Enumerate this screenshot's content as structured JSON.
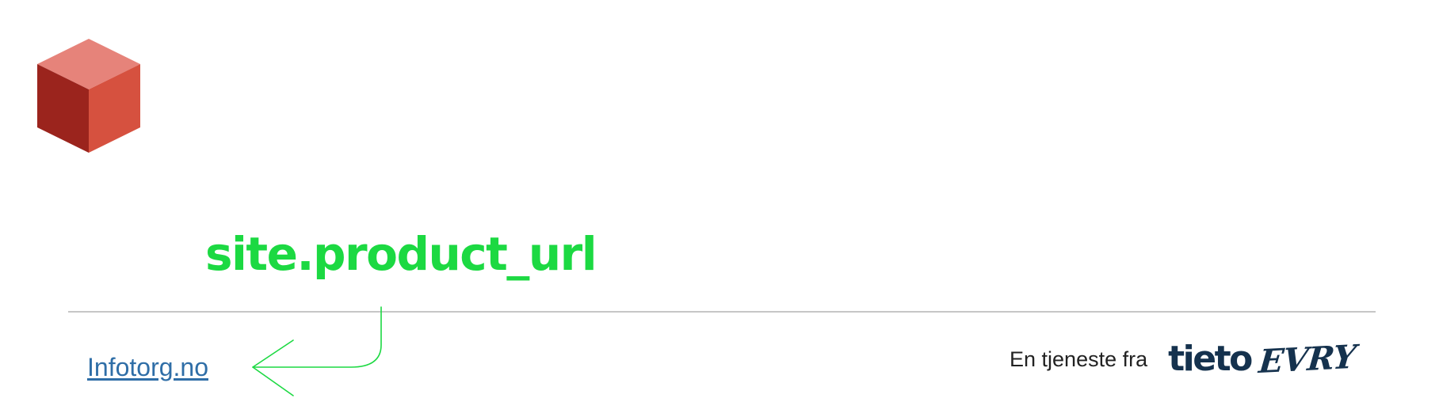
{
  "logo": {
    "icon": "cube-icon",
    "colors": {
      "top": "#e6837a",
      "left": "#9b241d",
      "right": "#d6513f"
    }
  },
  "annotation": {
    "label": "site.product_url",
    "color": "#1cd942",
    "icon": "arrow-left-icon"
  },
  "footer": {
    "divider_color": "#c6c6c6",
    "link": {
      "text": "Infotorg.no",
      "color": "#2f6ea7"
    },
    "vendor": {
      "prefix": "En tjeneste fra",
      "prefix_color": "#222222",
      "logo_primary": "tieto",
      "logo_secondary": "EVRY",
      "logo_color": "#15324e"
    }
  }
}
